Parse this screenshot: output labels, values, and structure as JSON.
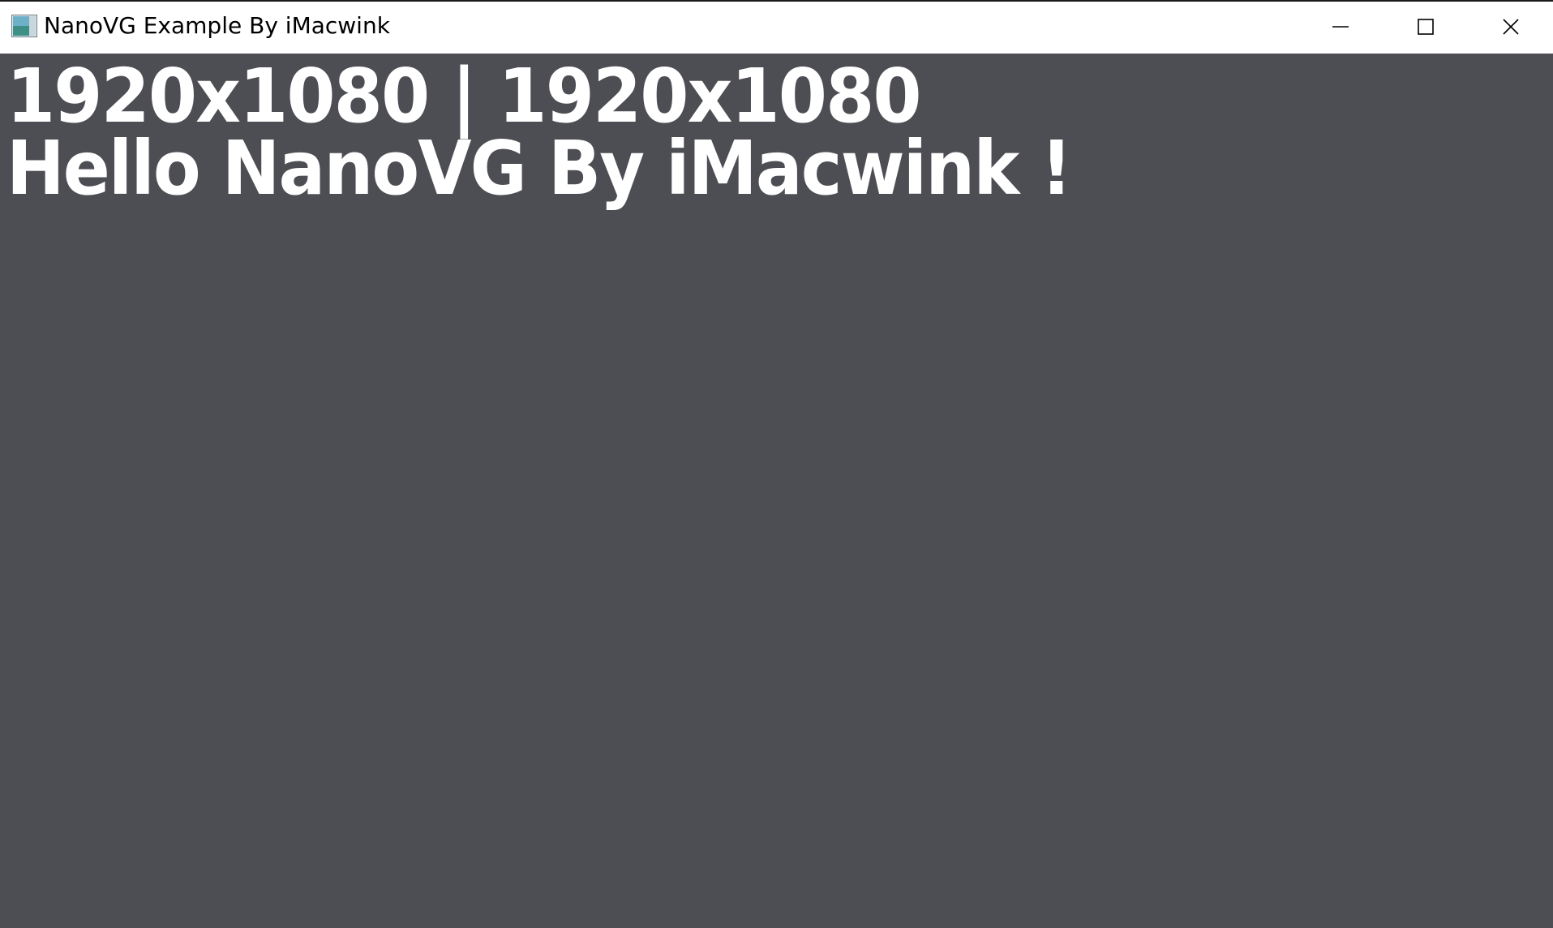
{
  "window": {
    "title": "NanoVG Example By iMacwink",
    "icon": "app-icon",
    "controls": {
      "minimize_icon": "minimize-icon",
      "maximize_icon": "maximize-icon",
      "close_icon": "close-icon"
    }
  },
  "canvas": {
    "background_color": "#4d4d54",
    "text_color": "#ffffff",
    "resolution_text": "1920x1080 | 1920x1080",
    "greeting_text": "Hello NanoVG By iMacwink !"
  }
}
